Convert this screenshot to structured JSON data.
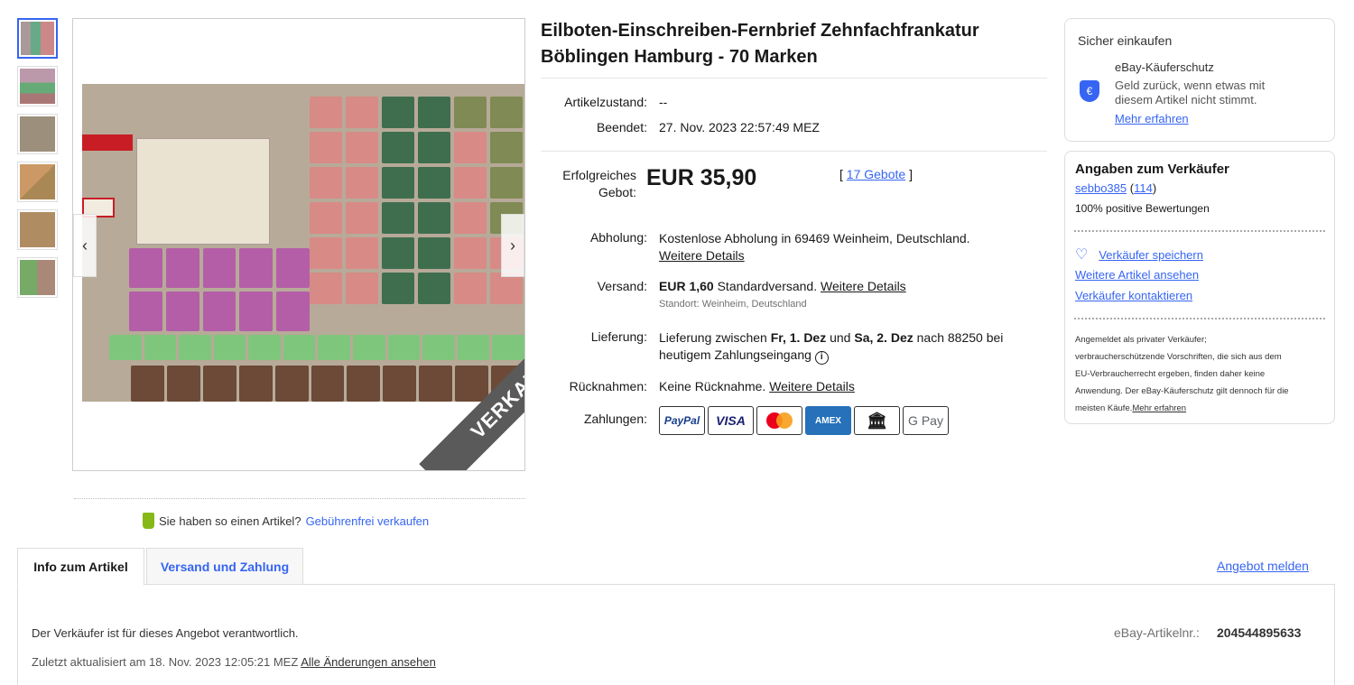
{
  "gallery": {
    "thumbnails": [
      "thumb-1",
      "thumb-2",
      "thumb-3",
      "thumb-4",
      "thumb-5",
      "thumb-6"
    ],
    "selected_index": 0,
    "sold_label": "VERKAUFT"
  },
  "sell_prompt": {
    "question": "Sie haben so einen Artikel?",
    "link": "Gebührenfrei verkaufen"
  },
  "item": {
    "title": "Eilboten-Einschreiben-Fernbrief Zehnfachfrankatur Böblingen Hamburg - 70 Marken",
    "condition_label": "Artikelzustand:",
    "condition_value": "--",
    "ended_label": "Beendet:",
    "ended_value": "27. Nov. 2023 22:57:49 MEZ",
    "bid_label_1": "Erfolgreiches",
    "bid_label_2": "Gebot:",
    "price": "EUR 35,90",
    "bids_link": "17 Gebote",
    "bids_open": "[",
    "bids_close": "]",
    "pickup_label": "Abholung:",
    "pickup_value": "Kostenlose Abholung in 69469 Weinheim, Deutschland.",
    "pickup_link": "Weitere Details",
    "shipping_label": "Versand:",
    "shipping_price": "EUR 1,60",
    "shipping_text": "Standardversand.",
    "shipping_link": "Weitere Details",
    "location": "Standort: Weinheim, Deutschland",
    "delivery_label": "Lieferung:",
    "delivery_1": "Lieferung zwischen",
    "delivery_d1": "Fr, 1. Dez",
    "delivery_2": "und",
    "delivery_d2": "Sa, 2. Dez",
    "delivery_3": "nach 88250 bei",
    "delivery_4": "heutigem Zahlungseingang",
    "returns_label": "Rücknahmen:",
    "returns_value": "Keine Rücknahme.",
    "returns_link": "Weitere Details",
    "payments_label": "Zahlungen:",
    "payments": [
      "PayPal",
      "VISA",
      "Mastercard",
      "AMEX",
      "bank-transfer",
      "G Pay"
    ]
  },
  "protection": {
    "heading": "Sicher einkaufen",
    "title": "eBay-Käuferschutz",
    "line1": "Geld zurück, wenn etwas mit",
    "line2": "diesem Artikel nicht stimmt.",
    "link": "Mehr erfahren"
  },
  "seller": {
    "heading": "Angaben zum Verkäufer",
    "name": "sebbo385",
    "score": "114",
    "feedback": "100% positive Bewertungen",
    "save": "Verkäufer speichern",
    "more_items": "Weitere Artikel ansehen",
    "contact": "Verkäufer kontaktieren",
    "note_1": "Angemeldet als privater Verkäufer;",
    "note_2": "verbraucherschützende Vorschriften, die sich aus dem",
    "note_3": "EU-Verbraucherrecht ergeben, finden daher keine",
    "note_4": "Anwendung. Der eBay-Käuferschutz gilt dennoch für die",
    "note_5": "meisten Käufe.",
    "note_link": "Mehr erfahren"
  },
  "tabs": {
    "info": "Info zum Artikel",
    "shipping": "Versand und Zahlung",
    "report": "Angebot melden"
  },
  "details": {
    "responsible": "Der Verkäufer ist für dieses Angebot verantwortlich.",
    "item_no_label": "eBay-Artikelnr.:",
    "item_no": "204544895633",
    "updated": "Zuletzt aktualisiert am 18. Nov. 2023 12:05:21 MEZ",
    "changes_link": "Alle Änderungen ansehen"
  }
}
